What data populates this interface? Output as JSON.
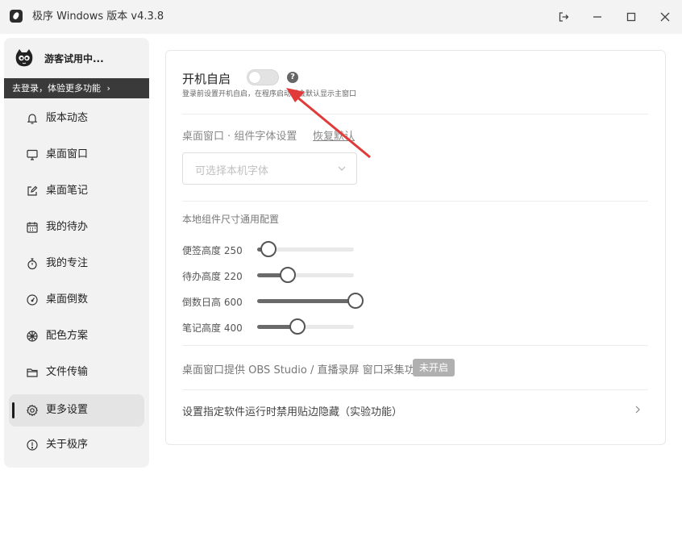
{
  "titlebar": {
    "title": "极序 Windows 版本 v4.3.8"
  },
  "sidebar": {
    "user_name": "游客试用中...",
    "login_prompt": "去登录，体验更多功能",
    "items": [
      {
        "label": "版本动态",
        "icon": "bell-icon"
      },
      {
        "label": "桌面窗口",
        "icon": "monitor-icon"
      },
      {
        "label": "桌面笔记",
        "icon": "edit-icon"
      },
      {
        "label": "我的待办",
        "icon": "calendar-icon"
      },
      {
        "label": "我的专注",
        "icon": "stopwatch-icon"
      },
      {
        "label": "桌面倒数",
        "icon": "gauge-icon"
      },
      {
        "label": "配色方案",
        "icon": "palette-icon"
      },
      {
        "label": "文件传输",
        "icon": "folder-icon"
      },
      {
        "label": "更多设置",
        "icon": "gear-icon",
        "active": true
      },
      {
        "label": "关于极序",
        "icon": "info-icon"
      }
    ]
  },
  "settings": {
    "autostart": {
      "title": "开机自启",
      "enabled": false,
      "help": "?",
      "note": "登录前设置开机自启，在程序启动后会默认显示主窗口"
    },
    "font": {
      "label": "桌面窗口 · 组件字体设置",
      "reset_link": "恢复默认",
      "placeholder": "可选择本机字体"
    },
    "size": {
      "label": "本地组件尺寸通用配置",
      "sliders": [
        {
          "label": "便签高度 250",
          "fraction": 0.1
        },
        {
          "label": "待办高度 220",
          "fraction": 0.3
        },
        {
          "label": "倒数日高 600",
          "fraction": 1.0
        },
        {
          "label": "笔记高度 400",
          "fraction": 0.4
        }
      ]
    },
    "obs": {
      "label": "桌面窗口提供 OBS Studio / 直播录屏 窗口采集功能",
      "status": "未开启"
    },
    "hide": {
      "label": "设置指定软件运行时禁用贴边隐藏（实验功能）"
    }
  },
  "colors": {
    "annotation_arrow": "#e03a3a",
    "active_indicator": "#1a1a1a"
  }
}
